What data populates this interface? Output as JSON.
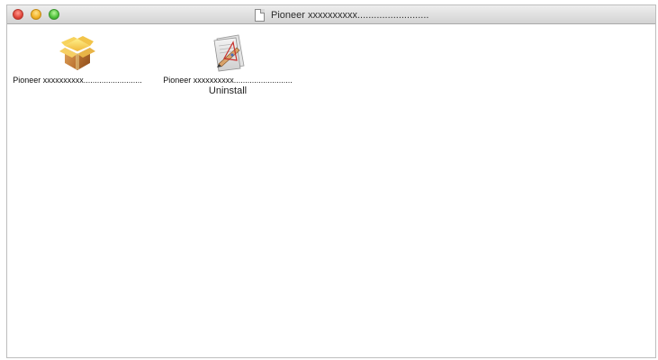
{
  "window": {
    "title": "Pioneer xxxxxxxxxx.........................."
  },
  "items": [
    {
      "label": "Pioneer xxxxxxxxxx..........................",
      "icon": "package-box-icon"
    },
    {
      "label": "Pioneer xxxxxxxxxx..........................",
      "sublabel": "Uninstall",
      "icon": "script-editor-icon"
    }
  ]
}
